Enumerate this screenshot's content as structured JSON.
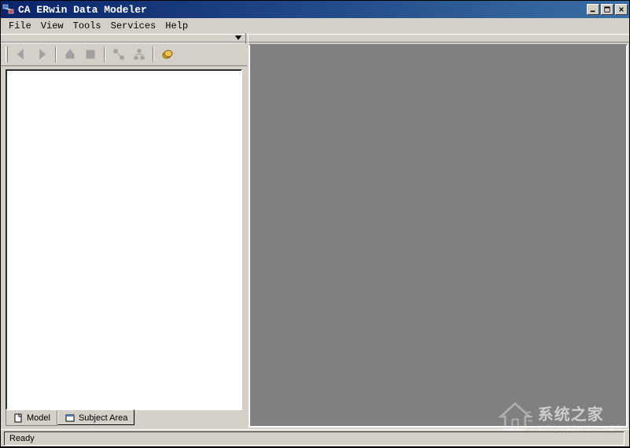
{
  "window": {
    "title": "CA ERwin Data Modeler"
  },
  "menu": {
    "file": "File",
    "view": "View",
    "tools": "Tools",
    "services": "Services",
    "help": "Help"
  },
  "toolbar_icons": {
    "nav_back": "nav-back",
    "nav_forward": "nav-forward",
    "go_up": "go-up",
    "entity": "entity",
    "relationship": "relationship",
    "subtype": "subtype",
    "bulk_editor": "bulk-editor"
  },
  "tabs": {
    "model": "Model",
    "subject_area": "Subject Area"
  },
  "status": {
    "ready": "Ready"
  },
  "watermark": {
    "cn": "系统之家",
    "en": "XITONGZHIJIA.NET"
  }
}
